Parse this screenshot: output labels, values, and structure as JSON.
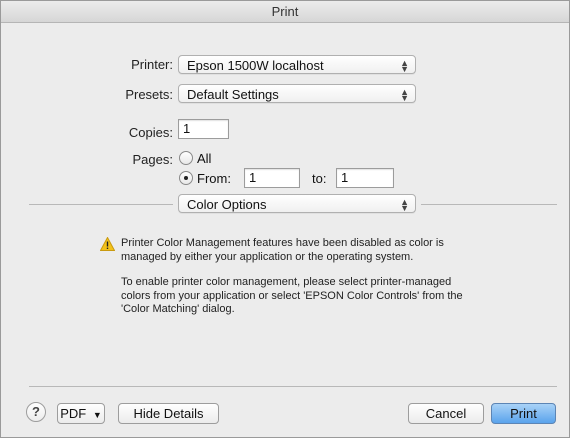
{
  "window": {
    "title": "Print"
  },
  "printer": {
    "label": "Printer:",
    "value": "Epson 1500W localhost"
  },
  "presets": {
    "label": "Presets:",
    "value": "Default Settings"
  },
  "copies": {
    "label": "Copies:",
    "value": "1"
  },
  "pages": {
    "label": "Pages:",
    "all_label": "All",
    "from_label": "From:",
    "from_value": "1",
    "to_label": "to:",
    "to_value": "1",
    "selected": "from"
  },
  "section_popup": {
    "value": "Color Options"
  },
  "warning": {
    "icon": "warning-triangle-icon",
    "line1": "Printer Color Management features have been disabled as color is",
    "line2": "managed by either your application or the operating system.",
    "line3": "To enable printer color management, please select printer-managed",
    "line4": "colors from your application or select 'EPSON Color Controls' from the",
    "line5": "'Color Matching' dialog."
  },
  "footer": {
    "help_label": "?",
    "pdf_label": "PDF",
    "hide_details_label": "Hide Details",
    "cancel_label": "Cancel",
    "print_label": "Print"
  },
  "colors": {
    "accent": "#5aa3ec",
    "warning": "#f3c21a"
  }
}
